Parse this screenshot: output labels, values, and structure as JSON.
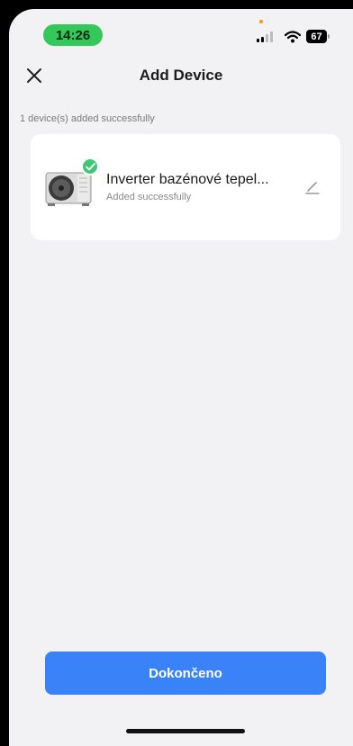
{
  "status_bar": {
    "time": "14:26",
    "battery": "67",
    "icons": [
      "signal-icon",
      "wifi-icon",
      "battery-icon"
    ]
  },
  "header": {
    "title": "Add Device",
    "close_icon": "close-icon"
  },
  "summary": {
    "added_text": "1 device(s) added successfully"
  },
  "device": {
    "name": "Inverter bazénové tepel...",
    "status": "Added successfully",
    "image_icon": "heat-pump-icon",
    "badge_icon": "check-icon",
    "edit_icon": "edit-pencil-icon"
  },
  "footer": {
    "done_label": "Dokončeno"
  },
  "colors": {
    "accent": "#3a82f7",
    "success": "#3fc776",
    "time_pill": "#34c759",
    "background": "#f2f2f4"
  }
}
